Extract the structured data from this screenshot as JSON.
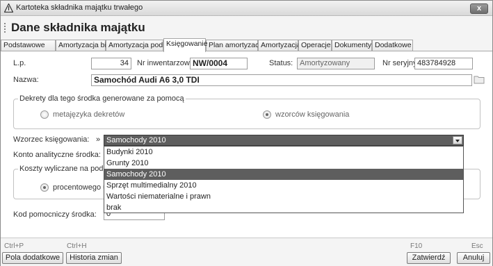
{
  "window": {
    "title": "Kartoteka składnika majątku trwałego",
    "close_label": "x"
  },
  "header": {
    "title": "Dane składnika majątku"
  },
  "tabs": [
    {
      "label": "Podstawowe"
    },
    {
      "label": "Amortyzacja bil."
    },
    {
      "label": "Amortyzacja pod."
    },
    {
      "label": "Księgowanie",
      "active": true
    },
    {
      "label": "Plan amortyzacji"
    },
    {
      "label": "Amortyzacja"
    },
    {
      "label": "Operacje"
    },
    {
      "label": "Dokumenty"
    },
    {
      "label": "Dodatkowe"
    }
  ],
  "form": {
    "lp_label": "L.p.",
    "lp_value": "34",
    "inventory_label": "Nr inwentarzowy",
    "inventory_value": "NW/0004",
    "status_label": "Status:",
    "status_value": "Amortyzowany",
    "serial_label": "Nr seryjny:",
    "serial_value": "483784928",
    "name_label": "Nazwa:",
    "name_value": "Samochód Audi A6 3,0 TDI"
  },
  "decrees": {
    "title": "Dekrety dla tego środka generowane za pomocą",
    "option1": "metajęzyka dekretów",
    "option2": "wzorców księgowania",
    "selected": "option2"
  },
  "posting": {
    "template_label": "Wzorzec księgowania:",
    "arrow": "»",
    "template_value": "Samochody 2010",
    "account_label": "Konto analityczne środka:",
    "options": [
      "Budynki 2010",
      "Grunty 2010",
      "Samochody 2010",
      "Sprzęt multimedialny 2010",
      "Wartości niematerialne i prawn",
      "brak"
    ],
    "selected_index": 2
  },
  "costs": {
    "title": "Koszty wyliczane na podst",
    "option1": "procentowego udz"
  },
  "aux": {
    "label": "Kod pomocniczy środka:",
    "value": "0"
  },
  "footer": {
    "key_extra": "Ctrl+P",
    "key_history": "Ctrl+H",
    "key_confirm": "F10",
    "key_cancel": "Esc",
    "extra_button": "Pola dodatkowe",
    "history_button": "Historia zmian",
    "confirm_button": "Zatwierdź",
    "cancel_button": "Anuluj"
  }
}
